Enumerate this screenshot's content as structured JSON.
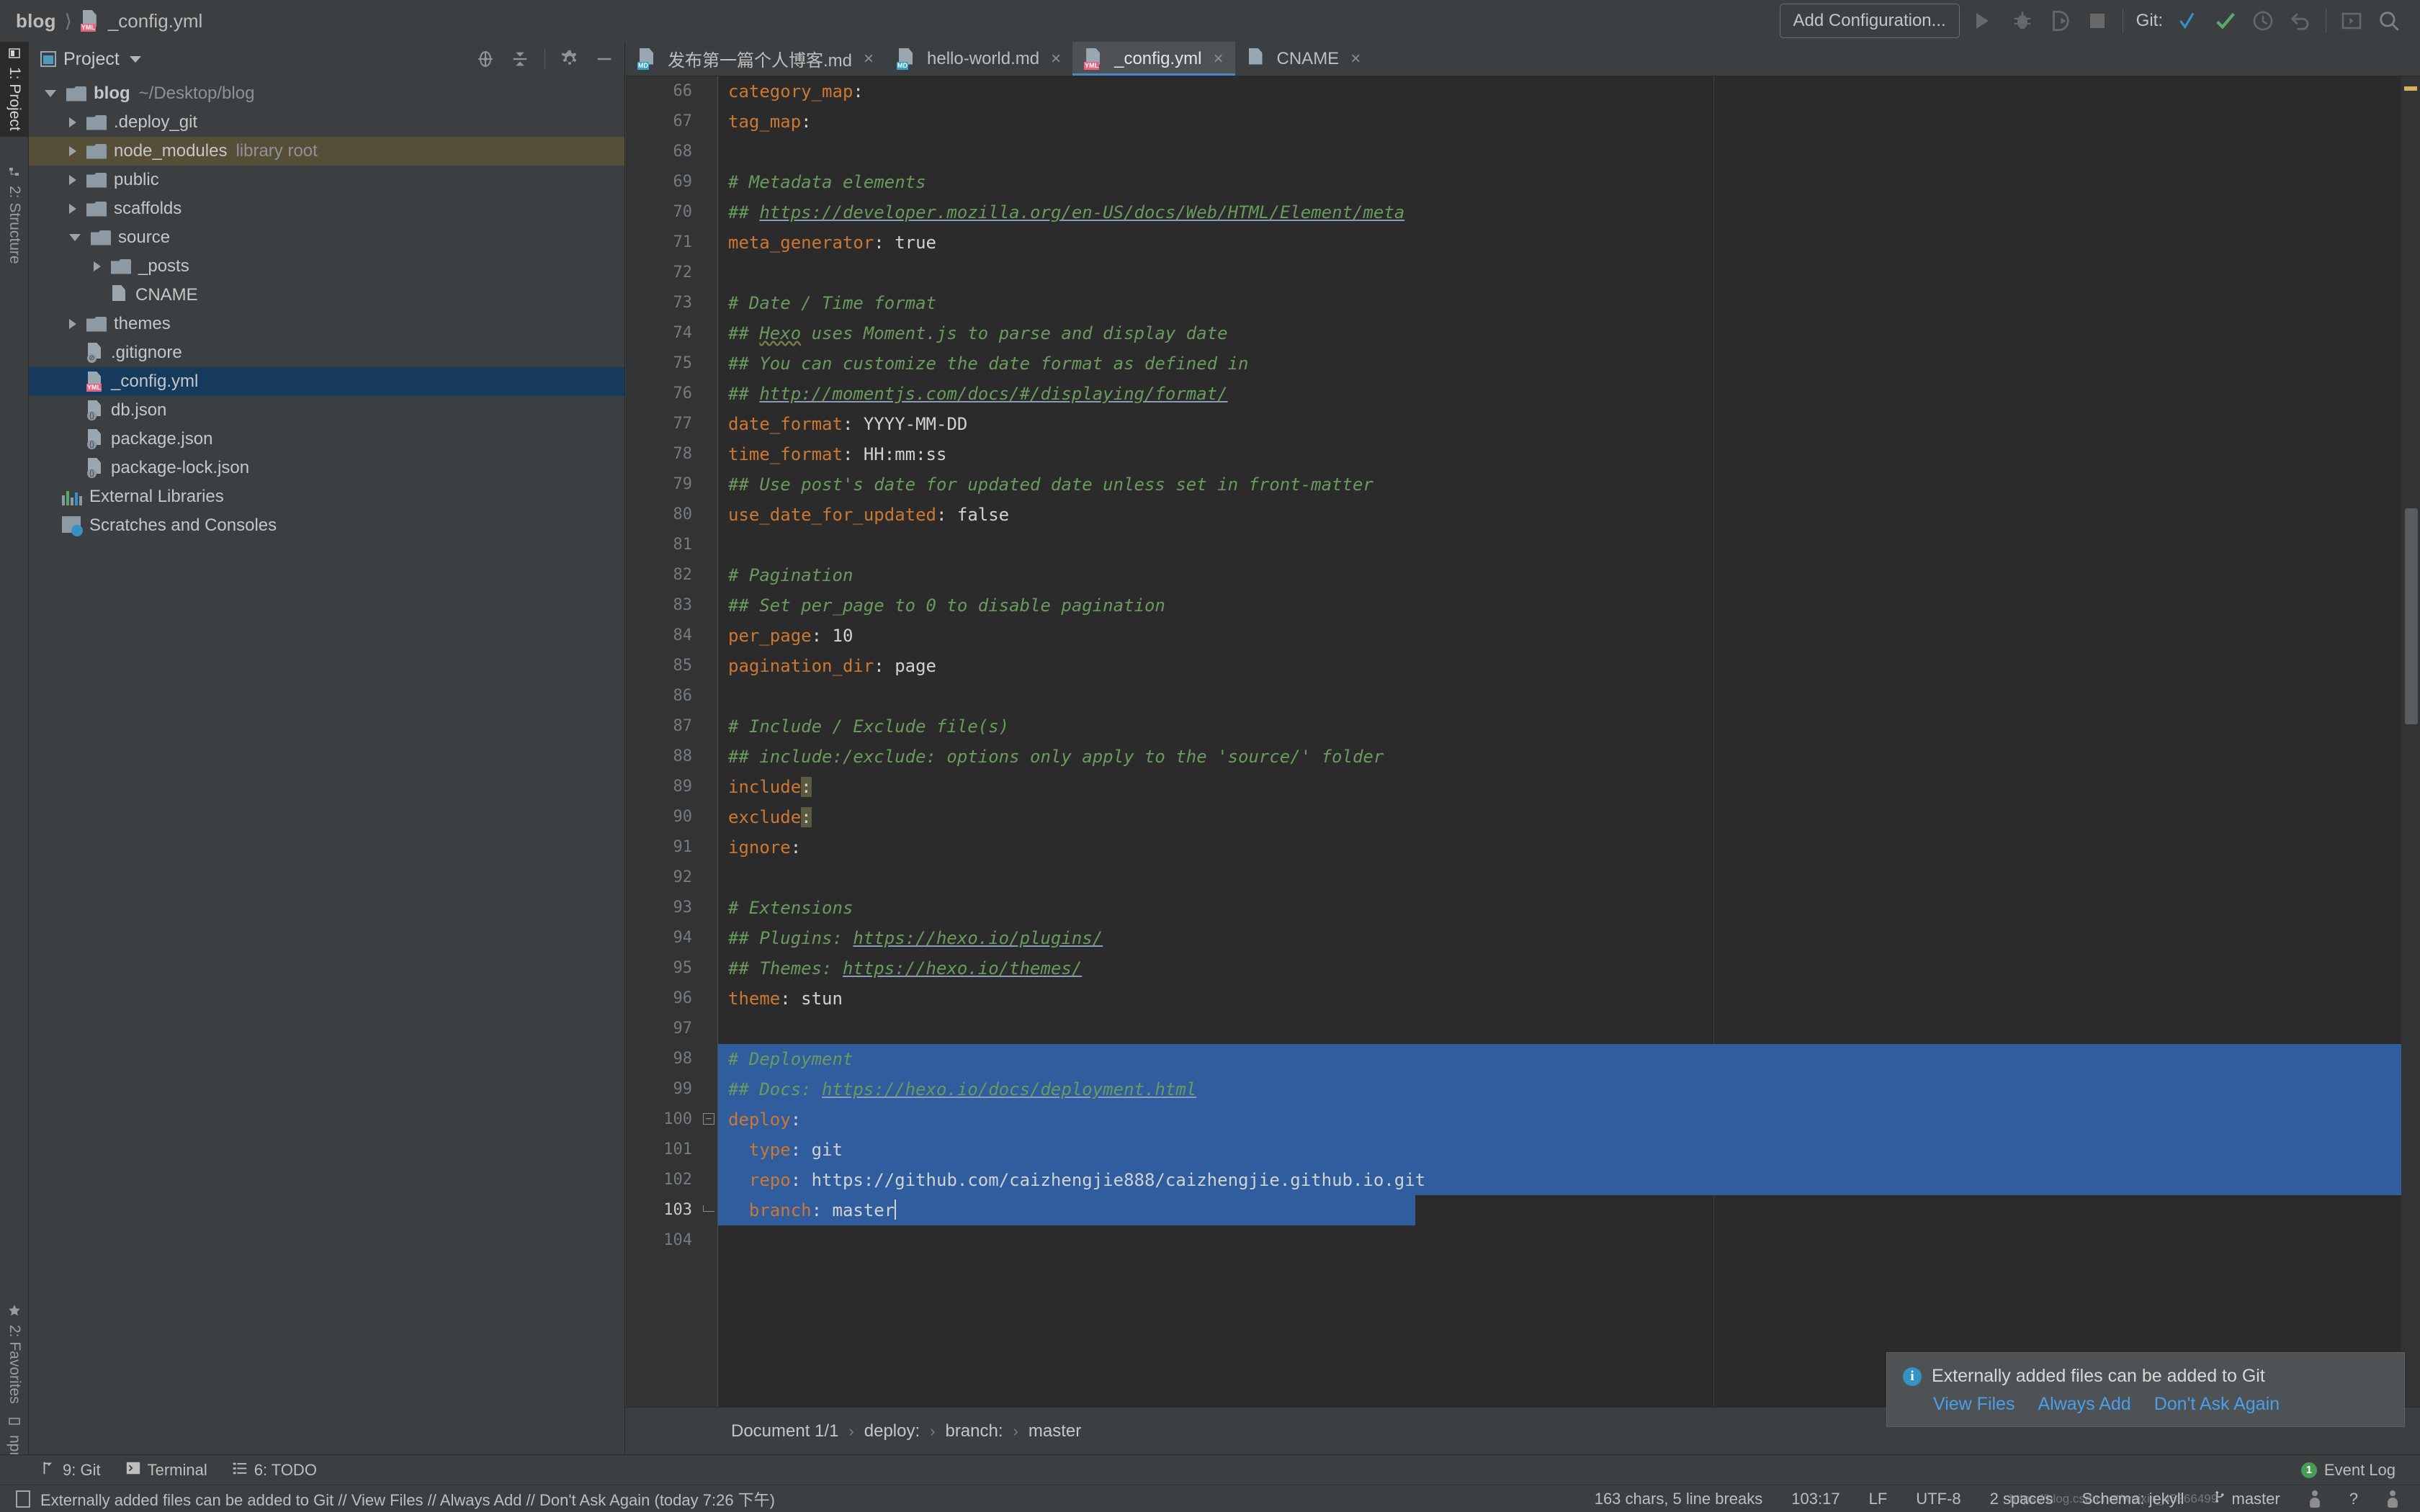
{
  "window": {
    "breadcrumb": {
      "project": "blog",
      "separator": "〉",
      "file": "_config.yml",
      "file_icon": "yml-file-icon"
    }
  },
  "toolbar": {
    "add_configuration": "Add Configuration...",
    "run_icon": "run-icon",
    "debug_icon": "debug-icon",
    "coverage_icon": "run-with-coverage-icon",
    "stop_icon": "stop-icon",
    "git_label": "Git:",
    "update_project_icon": "update-project-icon",
    "commit_icon": "commit-checkmark-icon",
    "history_icon": "history-clock-icon",
    "rollback_icon": "rollback-icon",
    "terminal_icon": "terminal-icon",
    "search_icon": "search-everywhere-icon"
  },
  "left_tool_strip": [
    {
      "label": "1: Project",
      "icon": "project-icon",
      "selected": true
    },
    {
      "label": "2: Structure",
      "icon": "structure-icon",
      "selected": false
    },
    {
      "label": "2: Favorites",
      "icon": "star-icon",
      "selected": false
    },
    {
      "label": "npm",
      "icon": "npm-icon",
      "selected": false
    }
  ],
  "project_panel": {
    "title": "Project",
    "caret_icon": "chevron-down-icon",
    "actions": [
      {
        "name": "scroll-from-source-icon"
      },
      {
        "name": "collapse-all-icon"
      },
      {
        "name": "settings-gear-icon"
      },
      {
        "name": "hide-panel-icon"
      }
    ],
    "tree": [
      {
        "label": "blog",
        "suffix": "~/Desktop/blog",
        "indent": 0,
        "arrow": "open",
        "icon": "folder",
        "bold": true,
        "state": ""
      },
      {
        "label": ".deploy_git",
        "suffix": "",
        "indent": 1,
        "arrow": "closed",
        "icon": "folder",
        "bold": false,
        "state": ""
      },
      {
        "label": "node_modules",
        "suffix": "library root",
        "indent": 1,
        "arrow": "closed",
        "icon": "folder",
        "bold": false,
        "state": "highlighted"
      },
      {
        "label": "public",
        "suffix": "",
        "indent": 1,
        "arrow": "closed",
        "icon": "folder",
        "bold": false,
        "state": ""
      },
      {
        "label": "scaffolds",
        "suffix": "",
        "indent": 1,
        "arrow": "closed",
        "icon": "folder",
        "bold": false,
        "state": ""
      },
      {
        "label": "source",
        "suffix": "",
        "indent": 1,
        "arrow": "open",
        "icon": "folder",
        "bold": false,
        "state": ""
      },
      {
        "label": "_posts",
        "suffix": "",
        "indent": 2,
        "arrow": "closed",
        "icon": "folder",
        "bold": false,
        "state": ""
      },
      {
        "label": "CNAME",
        "suffix": "",
        "indent": 2,
        "arrow": "none",
        "icon": "text-file",
        "bold": false,
        "state": ""
      },
      {
        "label": "themes",
        "suffix": "",
        "indent": 1,
        "arrow": "closed",
        "icon": "folder",
        "bold": false,
        "state": ""
      },
      {
        "label": ".gitignore",
        "suffix": "",
        "indent": 1,
        "arrow": "none",
        "icon": "ignore-file",
        "bold": false,
        "state": ""
      },
      {
        "label": "_config.yml",
        "suffix": "",
        "indent": 1,
        "arrow": "none",
        "icon": "yml-file",
        "bold": false,
        "state": "selected"
      },
      {
        "label": "db.json",
        "suffix": "",
        "indent": 1,
        "arrow": "none",
        "icon": "json-file",
        "bold": false,
        "state": ""
      },
      {
        "label": "package.json",
        "suffix": "",
        "indent": 1,
        "arrow": "none",
        "icon": "json-file",
        "bold": false,
        "state": ""
      },
      {
        "label": "package-lock.json",
        "suffix": "",
        "indent": 1,
        "arrow": "none",
        "icon": "json-file",
        "bold": false,
        "state": ""
      },
      {
        "label": "External Libraries",
        "suffix": "",
        "indent": 0,
        "arrow": "none",
        "icon": "library-icon",
        "bold": false,
        "state": ""
      },
      {
        "label": "Scratches and Consoles",
        "suffix": "",
        "indent": 0,
        "arrow": "none",
        "icon": "scratches-icon",
        "bold": false,
        "state": ""
      }
    ]
  },
  "editor_tabs": [
    {
      "label": "发布第一篇个人博客.md",
      "icon": "md",
      "active": false,
      "close": "×"
    },
    {
      "label": "hello-world.md",
      "icon": "md",
      "active": false,
      "close": "×"
    },
    {
      "label": "_config.yml",
      "icon": "yml",
      "active": true,
      "close": "×"
    },
    {
      "label": "CNAME",
      "icon": "txt",
      "active": false,
      "close": "×"
    }
  ],
  "editor": {
    "first_visible_line": 66,
    "cursor_line": 103,
    "lines": [
      {
        "n": 66,
        "parts": [
          {
            "t": "key",
            "s": "category_map"
          },
          {
            "t": "val",
            "s": ":"
          }
        ]
      },
      {
        "n": 67,
        "parts": [
          {
            "t": "key",
            "s": "tag_map"
          },
          {
            "t": "val",
            "s": ":"
          }
        ]
      },
      {
        "n": 68,
        "parts": []
      },
      {
        "n": 69,
        "parts": [
          {
            "t": "cmt",
            "s": "# Metadata elements"
          }
        ]
      },
      {
        "n": 70,
        "parts": [
          {
            "t": "cmt",
            "s": "## "
          },
          {
            "t": "lnk",
            "s": "https://developer.mozilla.org/en-US/docs/Web/HTML/Element/meta"
          }
        ]
      },
      {
        "n": 71,
        "parts": [
          {
            "t": "key",
            "s": "meta_generator"
          },
          {
            "t": "val",
            "s": ": true"
          }
        ]
      },
      {
        "n": 72,
        "parts": []
      },
      {
        "n": 73,
        "parts": [
          {
            "t": "cmt",
            "s": "# Date / Time format"
          }
        ]
      },
      {
        "n": 74,
        "parts": [
          {
            "t": "cmt",
            "s": "## "
          },
          {
            "t": "typo",
            "s": "Hexo"
          },
          {
            "t": "cmt",
            "s": " uses Moment.js to parse and display date"
          }
        ]
      },
      {
        "n": 75,
        "parts": [
          {
            "t": "cmt",
            "s": "## You can customize the date format as defined in"
          }
        ]
      },
      {
        "n": 76,
        "parts": [
          {
            "t": "cmt",
            "s": "## "
          },
          {
            "t": "lnk",
            "s": "http://momentjs.com/docs/#/displaying/format/"
          }
        ]
      },
      {
        "n": 77,
        "parts": [
          {
            "t": "key",
            "s": "date_format"
          },
          {
            "t": "val",
            "s": ": YYYY-MM-DD"
          }
        ]
      },
      {
        "n": 78,
        "parts": [
          {
            "t": "key",
            "s": "time_format"
          },
          {
            "t": "val",
            "s": ": HH:mm:ss"
          }
        ]
      },
      {
        "n": 79,
        "parts": [
          {
            "t": "cmt",
            "s": "## Use post's date for updated date unless set in front-matter"
          }
        ]
      },
      {
        "n": 80,
        "parts": [
          {
            "t": "key",
            "s": "use_date_for_updated"
          },
          {
            "t": "val",
            "s": ": false"
          }
        ]
      },
      {
        "n": 81,
        "parts": []
      },
      {
        "n": 82,
        "parts": [
          {
            "t": "cmt",
            "s": "# Pagination"
          }
        ]
      },
      {
        "n": 83,
        "parts": [
          {
            "t": "cmt",
            "s": "## Set per_page to 0 to disable pagination"
          }
        ]
      },
      {
        "n": 84,
        "parts": [
          {
            "t": "key",
            "s": "per_page"
          },
          {
            "t": "val",
            "s": ": 10"
          }
        ]
      },
      {
        "n": 85,
        "parts": [
          {
            "t": "key",
            "s": "pagination_dir"
          },
          {
            "t": "val",
            "s": ": page"
          }
        ]
      },
      {
        "n": 86,
        "parts": []
      },
      {
        "n": 87,
        "parts": [
          {
            "t": "cmt",
            "s": "# Include / Exclude file(s)"
          }
        ]
      },
      {
        "n": 88,
        "parts": [
          {
            "t": "cmt",
            "s": "## include:/exclude: options only apply to the 'source/' folder"
          }
        ]
      },
      {
        "n": 89,
        "parts": [
          {
            "t": "key",
            "s": "include"
          },
          {
            "t": "hl",
            "s": ":"
          }
        ]
      },
      {
        "n": 90,
        "parts": [
          {
            "t": "key",
            "s": "exclude"
          },
          {
            "t": "hl",
            "s": ":"
          }
        ]
      },
      {
        "n": 91,
        "parts": [
          {
            "t": "key",
            "s": "ignore"
          },
          {
            "t": "val",
            "s": ":"
          }
        ]
      },
      {
        "n": 92,
        "parts": []
      },
      {
        "n": 93,
        "parts": [
          {
            "t": "cmt",
            "s": "# Extensions"
          }
        ]
      },
      {
        "n": 94,
        "parts": [
          {
            "t": "cmt",
            "s": "## Plugins: "
          },
          {
            "t": "lnk",
            "s": "https://hexo.io/plugins/"
          }
        ]
      },
      {
        "n": 95,
        "parts": [
          {
            "t": "cmt",
            "s": "## Themes: "
          },
          {
            "t": "lnk",
            "s": "https://hexo.io/themes/"
          }
        ]
      },
      {
        "n": 96,
        "parts": [
          {
            "t": "key",
            "s": "theme"
          },
          {
            "t": "val",
            "s": ": stun"
          }
        ]
      },
      {
        "n": 97,
        "parts": []
      },
      {
        "n": 98,
        "parts": [
          {
            "t": "cmt",
            "s": "# Deployment"
          }
        ],
        "sel": true
      },
      {
        "n": 99,
        "parts": [
          {
            "t": "cmt",
            "s": "## Docs: "
          },
          {
            "t": "lnk",
            "s": "https://hexo.io/docs/deployment.html"
          }
        ],
        "sel": true
      },
      {
        "n": 100,
        "parts": [
          {
            "t": "key",
            "s": "deploy"
          },
          {
            "t": "val",
            "s": ":"
          }
        ],
        "sel": true,
        "fold": "collapse"
      },
      {
        "n": 101,
        "parts": [
          {
            "t": "key",
            "s": "  type"
          },
          {
            "t": "val",
            "s": ": git"
          }
        ],
        "sel": true
      },
      {
        "n": 102,
        "parts": [
          {
            "t": "key",
            "s": "  repo"
          },
          {
            "t": "val",
            "s": ": https://github.com/caizhengjie888/caizhengjie.github.io.git"
          }
        ],
        "sel": true,
        "bulb": true
      },
      {
        "n": 103,
        "parts": [
          {
            "t": "key",
            "s": "  branch"
          },
          {
            "t": "val",
            "s": ": master"
          }
        ],
        "sel": true,
        "selpartial": true,
        "caret": true,
        "fold": "end"
      },
      {
        "n": 104,
        "parts": []
      }
    ],
    "breadcrumb": [
      "Document 1/1",
      "deploy:",
      "branch:",
      "master"
    ],
    "breadcrumb_separator": "›"
  },
  "notification": {
    "icon": "info-icon",
    "message": "Externally added files can be added to Git",
    "actions": [
      "View Files",
      "Always Add",
      "Don't Ask Again"
    ]
  },
  "bottom_tool_strip": [
    {
      "label": "9: Git",
      "underline": "9",
      "icon": "git-branch-icon"
    },
    {
      "label": "Terminal",
      "underline": "",
      "icon": "terminal-icon"
    },
    {
      "label": "6: TODO",
      "underline": "6",
      "icon": "todo-list-icon"
    }
  ],
  "event_log": {
    "label": "Event Log",
    "badge": "1"
  },
  "status_bar": {
    "message_icon": "document-icon",
    "message": "Externally added files can be added to Git // View Files // Always Add // Don't Ask Again (today 7:26 下午)",
    "right": [
      "163 chars, 5 line breaks",
      "103:17",
      "LF",
      "UTF-8",
      "2 spaces",
      "Schema: jekyll",
      "master"
    ],
    "watermark": "https://blog.csdn.net/weixin_45366499"
  },
  "colors": {
    "accent_blue": "#4a88c7",
    "selection_blue": "#2f5d9e",
    "tree_selection": "#153a5b",
    "comment_green": "#699a5e",
    "key_orange": "#cc7832",
    "value_grey": "#d0d2d4",
    "editor_bg": "#2b2b2b",
    "panel_bg": "#3c3f41"
  }
}
